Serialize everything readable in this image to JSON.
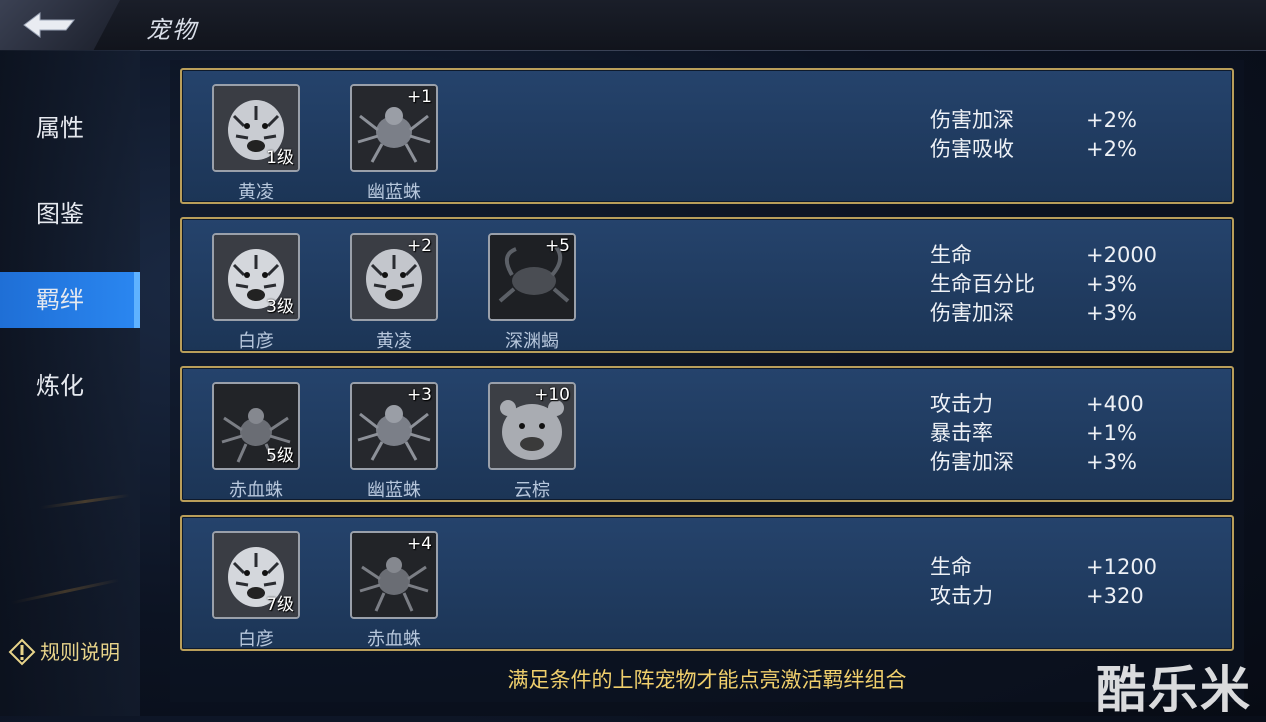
{
  "header": {
    "title": "宠物"
  },
  "sidebar": {
    "items": [
      {
        "label": "属性",
        "active": false
      },
      {
        "label": "图鉴",
        "active": false
      },
      {
        "label": "羁绊",
        "active": true
      },
      {
        "label": "炼化",
        "active": false
      }
    ],
    "rules_label": "规则说明"
  },
  "bonds": [
    {
      "pets": [
        {
          "name": "黄凌",
          "level": "1级",
          "tag": "",
          "icon": "white-tiger-icon"
        },
        {
          "name": "幽蓝蛛",
          "level": "",
          "tag": "+1",
          "icon": "blue-spider-icon"
        }
      ],
      "bonuses": [
        {
          "label": "伤害加深",
          "value": "+2%"
        },
        {
          "label": "伤害吸收",
          "value": "+2%"
        }
      ]
    },
    {
      "pets": [
        {
          "name": "白彦",
          "level": "3级",
          "tag": "",
          "icon": "white-tiger-icon"
        },
        {
          "name": "黄凌",
          "level": "",
          "tag": "+2",
          "icon": "white-tiger-icon"
        },
        {
          "name": "深渊蝎",
          "level": "",
          "tag": "+5",
          "icon": "scorpion-icon"
        }
      ],
      "bonuses": [
        {
          "label": "生命",
          "value": "+2000"
        },
        {
          "label": "生命百分比",
          "value": "+3%"
        },
        {
          "label": "伤害加深",
          "value": "+3%"
        }
      ]
    },
    {
      "pets": [
        {
          "name": "赤血蛛",
          "level": "5级",
          "tag": "",
          "icon": "red-spider-icon"
        },
        {
          "name": "幽蓝蛛",
          "level": "",
          "tag": "+3",
          "icon": "blue-spider-icon"
        },
        {
          "name": "云棕",
          "level": "",
          "tag": "+10",
          "icon": "bear-icon"
        }
      ],
      "bonuses": [
        {
          "label": "攻击力",
          "value": "+400"
        },
        {
          "label": "暴击率",
          "value": "+1%"
        },
        {
          "label": "伤害加深",
          "value": "+3%"
        }
      ]
    },
    {
      "pets": [
        {
          "name": "白彦",
          "level": "7级",
          "tag": "",
          "icon": "white-tiger-icon"
        },
        {
          "name": "赤血蛛",
          "level": "",
          "tag": "+4",
          "icon": "red-spider-icon"
        }
      ],
      "bonuses": [
        {
          "label": "生命",
          "value": "+1200"
        },
        {
          "label": "攻击力",
          "value": "+320"
        }
      ]
    }
  ],
  "footer": {
    "tip": "满足条件的上阵宠物才能点亮激活羁绊组合"
  },
  "watermark": "酷乐米",
  "colors": {
    "accent": "#2a86f0",
    "gold": "#b99e5a",
    "tip": "#f0cf6c"
  }
}
